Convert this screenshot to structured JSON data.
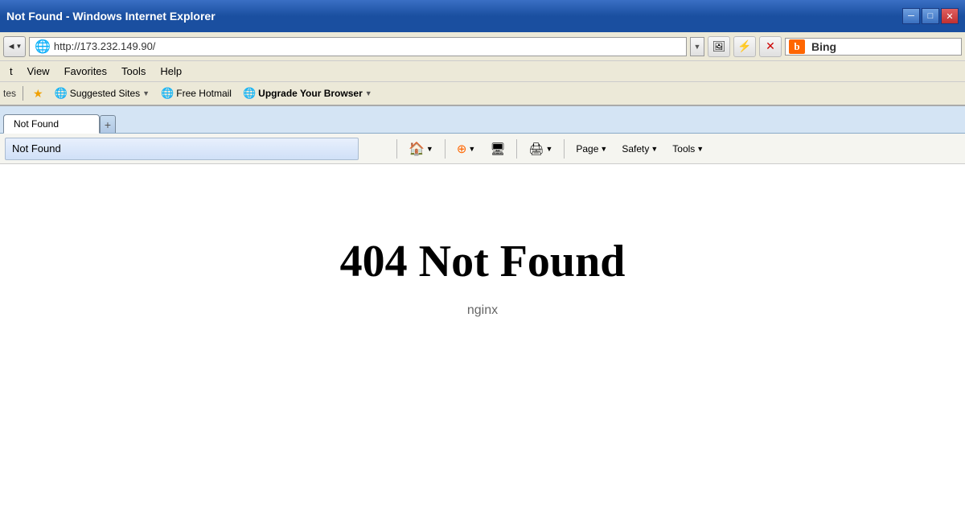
{
  "titleBar": {
    "title": "Not Found - Windows Internet Explorer",
    "minBtn": "─",
    "maxBtn": "□",
    "closeBtn": "✕"
  },
  "addressBar": {
    "url": "http://173.232.149.90/",
    "dropdownArrow": "▼",
    "refreshIcon": "⟳",
    "stopIcon": "✕",
    "backArrow": "◄",
    "navArrow": "▼"
  },
  "bingSearch": {
    "logoLetter": "b",
    "label": "Bing"
  },
  "menuBar": {
    "items": [
      "t",
      "View",
      "Favorites",
      "Tools",
      "Help"
    ]
  },
  "favoritesBar": {
    "separator": "|",
    "suggestedSites": "Suggested Sites",
    "freeHotmail": "Free Hotmail",
    "upgradeYourBrowser": "Upgrade Your Browser",
    "dropdownArrow": "▼"
  },
  "tabBar": {
    "activeTab": "Not Found",
    "newTabSymbol": "+"
  },
  "navToolbar": {
    "home": "🏠",
    "homeArrow": "▼",
    "rss": "RSS",
    "rssArrow": "▼",
    "monitor": "⬜",
    "print": "🖨",
    "printArrow": "▼",
    "page": "Page",
    "pageArrow": "▼",
    "safety": "Safety",
    "safetyArrow": "▼",
    "tools": "Tools",
    "toolsArrow": "▼",
    "tabTitle": "Not Found"
  },
  "pageContent": {
    "heading": "404 Not Found",
    "footer": "nginx"
  }
}
